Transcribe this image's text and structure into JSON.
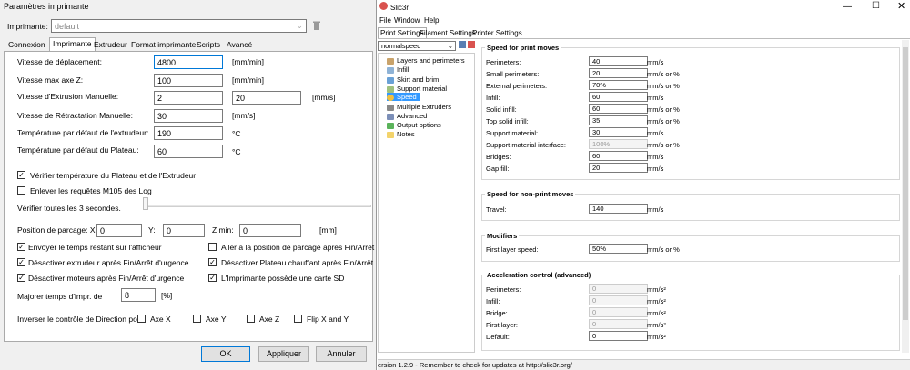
{
  "left": {
    "title": "Paramètres imprimante",
    "printer_label": "Imprimante:",
    "printer_value": "default",
    "tabs": [
      "Connexion",
      "Imprimante",
      "Extrudeur",
      "Format imprimante",
      "Scripts",
      "Avancé"
    ],
    "fields": {
      "travel_speed_label": "Vitesse de déplacement:",
      "travel_speed": "4800",
      "travel_unit": "[mm/min]",
      "zmax_label": "Vitesse max axe Z:",
      "zmax": "100",
      "zmax_unit": "[mm/min]",
      "manual_ext_label": "Vitesse d'Extrusion Manuelle:",
      "manual_ext_1": "2",
      "manual_ext_2": "20",
      "manual_ext_unit": "[mm/s]",
      "retract_label": "Vitesse de Rétractation Manuelle:",
      "retract": "30",
      "retract_unit": "[mm/s]",
      "ext_temp_label": "Température par défaut de l'extrudeur:",
      "ext_temp": "190",
      "ext_temp_unit": "°C",
      "bed_temp_label": "Température par défaut du Plateau:",
      "bed_temp": "60",
      "bed_temp_unit": "°C"
    },
    "check_temp": "Vérifier température du Plateau et de l'Extrudeur",
    "remove_m105": "Enlever les requêtes M105 des Log",
    "check_every": "Vérifier toutes les 3 secondes.",
    "park_label": "Position de parcage: X:",
    "park_x": "0",
    "park_y_label": "Y:",
    "park_y": "0",
    "park_zmin_label": "Z min:",
    "park_z": "0",
    "park_unit": "[mm]",
    "opts": [
      "Envoyer le temps restant sur l'afficheur",
      "Aller à la position de parcage après Fin/Arrêt d'urgence",
      "Désactiver extrudeur après Fin/Arrêt d'urgence",
      "Désactiver Plateau chauffant après Fin/Arrêt d'urgence",
      "Désactiver moteurs après Fin/Arrêt d'urgence",
      "L'Imprimante possède une carte SD"
    ],
    "increase_label": "Majorer temps d'impr. de",
    "increase_value": "8",
    "increase_unit": "[%]",
    "invert_label": "Inverser le contrôle de Direction pour",
    "axes": [
      "Axe X",
      "Axe Y",
      "Axe Z",
      "Flip X and Y"
    ],
    "ok": "OK",
    "apply": "Appliquer",
    "cancel": "Annuler"
  },
  "right": {
    "title": "Slic3r",
    "menu": [
      "File",
      "Window",
      "Help"
    ],
    "tabs": [
      "Print Settings",
      "Filament Settings",
      "Printer Settings"
    ],
    "preset": "normalspeed",
    "tree": [
      "Layers and perimeters",
      "Infill",
      "Skirt and brim",
      "Support material",
      "Speed",
      "Multiple Extruders",
      "Advanced",
      "Output options",
      "Notes"
    ],
    "print_moves_title": "Speed for print moves",
    "print_moves": [
      {
        "label": "Perimeters:",
        "value": "40",
        "unit": "mm/s"
      },
      {
        "label": "Small perimeters:",
        "value": "20",
        "unit": "mm/s or %"
      },
      {
        "label": "External perimeters:",
        "value": "70%",
        "unit": "mm/s or %"
      },
      {
        "label": "Infill:",
        "value": "60",
        "unit": "mm/s"
      },
      {
        "label": "Solid infill:",
        "value": "60",
        "unit": "mm/s or %"
      },
      {
        "label": "Top solid infill:",
        "value": "35",
        "unit": "mm/s or %"
      },
      {
        "label": "Support material:",
        "value": "30",
        "unit": "mm/s"
      },
      {
        "label": "Support material interface:",
        "value": "100%",
        "unit": "mm/s or %"
      },
      {
        "label": "Bridges:",
        "value": "60",
        "unit": "mm/s"
      },
      {
        "label": "Gap fill:",
        "value": "20",
        "unit": "mm/s"
      }
    ],
    "nonprint_title": "Speed for non-print moves",
    "travel_label": "Travel:",
    "travel_value": "140",
    "travel_unit": "mm/s",
    "modifiers_title": "Modifiers",
    "first_layer_label": "First layer speed:",
    "first_layer_value": "50%",
    "first_layer_unit": "mm/s or %",
    "accel_title": "Acceleration control (advanced)",
    "accel": [
      {
        "label": "Perimeters:",
        "value": "0",
        "unit": "mm/s²"
      },
      {
        "label": "Infill:",
        "value": "0",
        "unit": "mm/s²"
      },
      {
        "label": "Bridge:",
        "value": "0",
        "unit": "mm/s²"
      },
      {
        "label": "First layer:",
        "value": "0",
        "unit": "mm/s²"
      },
      {
        "label": "Default:",
        "value": "0",
        "unit": "mm/s²"
      }
    ],
    "status": "ersion 1.2.9 - Remember to check for updates at http://slic3r.org/"
  }
}
